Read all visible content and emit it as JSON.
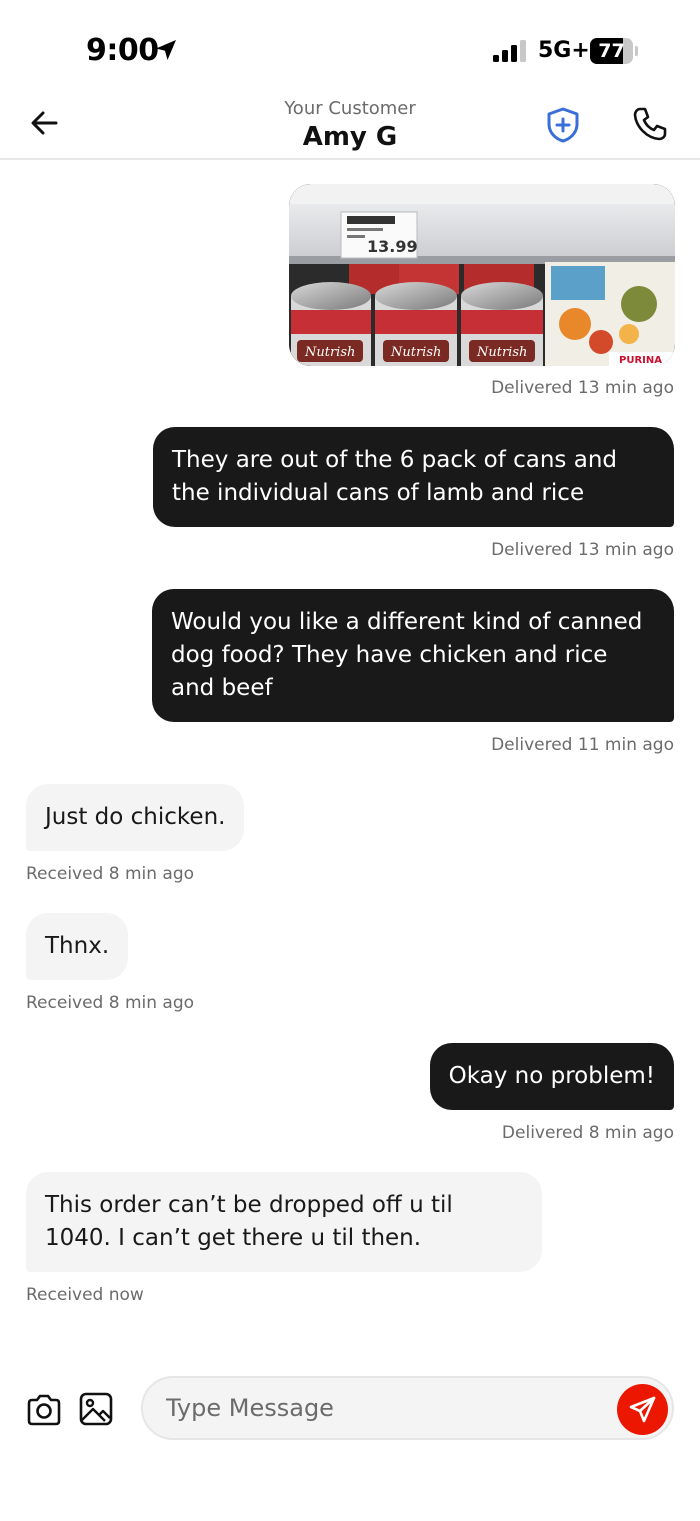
{
  "status_bar": {
    "time": "9:00",
    "network": "5G+",
    "battery": "77",
    "battery_level_percent": 77,
    "icons": [
      "location-arrow-icon",
      "signal-bars-icon",
      "battery-icon"
    ]
  },
  "header": {
    "subtitle": "Your Customer",
    "title": "Amy G",
    "icons": [
      "back-arrow-icon",
      "shield-plus-icon",
      "phone-icon"
    ],
    "accent_color": "#3b6fd8"
  },
  "photo": {
    "price_tag_price": "13.99",
    "can_brand": "Nutrish",
    "box_brand": "PURINA",
    "status": "Delivered 13 min ago"
  },
  "messages": [
    {
      "direction": "out",
      "text": "They are out of the 6 pack of cans and the individual cans of lamb and rice",
      "status": "Delivered 13 min ago"
    },
    {
      "direction": "out",
      "text": "Would you like a different kind of canned dog food? They have chicken and rice and beef",
      "status": "Delivered 11 min ago"
    },
    {
      "direction": "in",
      "text": "Just do chicken.",
      "status": "Received 8 min ago"
    },
    {
      "direction": "in",
      "text": "Thnx.",
      "status": "Received 8 min ago"
    },
    {
      "direction": "out",
      "text": "Okay no problem!",
      "status": "Delivered 8 min ago"
    },
    {
      "direction": "in",
      "text": "This order can’t be dropped off u til 1040. I can’t get there u til then.",
      "status": "Received now"
    }
  ],
  "composer": {
    "placeholder": "Type Message",
    "icons": [
      "camera-icon",
      "image-icon",
      "send-icon"
    ],
    "send_color": "#eb1700"
  }
}
